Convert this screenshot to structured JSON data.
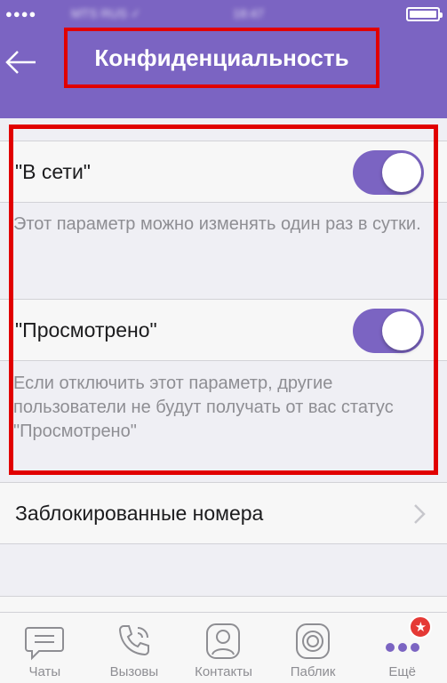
{
  "status_bar": {
    "signal": "●●●●",
    "carrier": "MTS RUS ✓",
    "time": "18:47",
    "battery_level": 1.0
  },
  "header": {
    "title": "Конфиденциальность",
    "back_icon": "arrow-left-icon"
  },
  "settings": {
    "online": {
      "label": "\"В сети\"",
      "enabled": true,
      "description": "Этот параметр можно изменять один раз в сутки."
    },
    "seen": {
      "label": "\"Просмотрено\"",
      "enabled": true,
      "description": "Если отключить этот параметр, другие пользователи не будут получать от вас статус \"Просмотрено\""
    },
    "blocked": {
      "label": "Заблокированные номера"
    }
  },
  "tabbar": {
    "items": [
      {
        "label": "Чаты",
        "icon": "chat-bubble-icon"
      },
      {
        "label": "Вызовы",
        "icon": "phone-icon"
      },
      {
        "label": "Контакты",
        "icon": "contact-icon"
      },
      {
        "label": "Паблик",
        "icon": "public-icon"
      },
      {
        "label": "Ещё",
        "icon": "more-dots-icon",
        "badge": "★"
      }
    ]
  },
  "colors": {
    "accent": "#7b64c2",
    "highlight": "#e10000",
    "badge": "#e53935",
    "background": "#efeff4"
  }
}
